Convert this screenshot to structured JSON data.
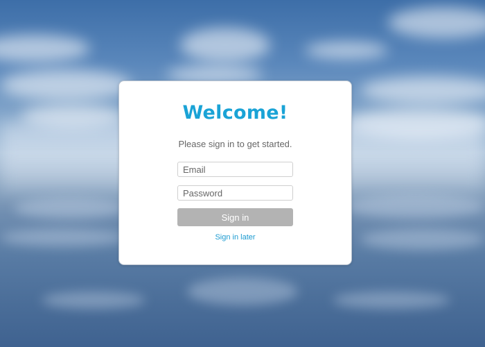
{
  "login": {
    "title": "Welcome!",
    "subtitle": "Please sign in to get started.",
    "email_placeholder": "Email",
    "email_value": "",
    "password_placeholder": "Password",
    "password_value": "",
    "signin_label": "Sign in",
    "later_label": "Sign in later"
  },
  "colors": {
    "accent": "#1aa3d6",
    "button_disabled": "#b3b3b3",
    "link": "#1a9ad0"
  }
}
